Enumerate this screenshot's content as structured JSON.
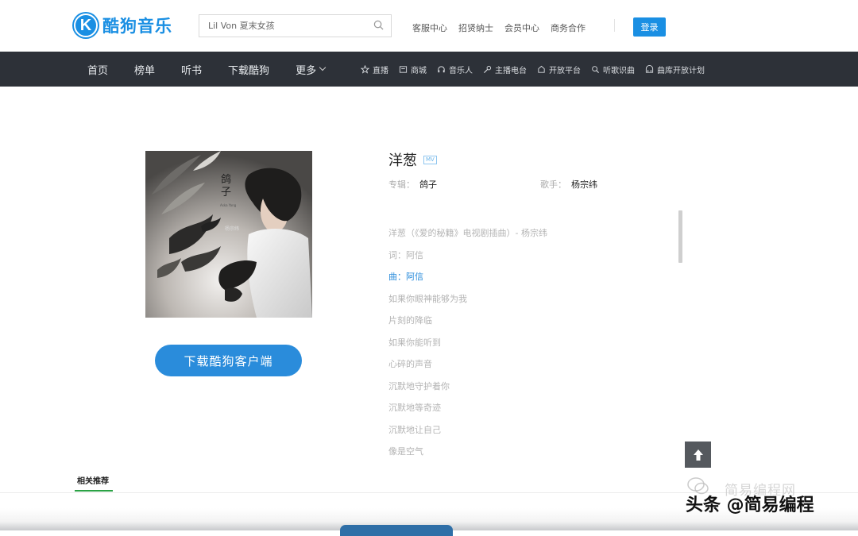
{
  "header": {
    "logo_letter": "K",
    "logo_text": "酷狗音乐",
    "brand_color": "#1a8fe3",
    "search_placeholder": "Lil Von 夏末女孩",
    "search_icon": "search-icon",
    "links": [
      "客服中心",
      "招贤纳士",
      "会员中心",
      "商务合作"
    ],
    "login_label": "登录"
  },
  "nav": {
    "main": [
      "首页",
      "榜单",
      "听书",
      "下载酷狗"
    ],
    "more_label": "更多",
    "sub": [
      {
        "label": "直播",
        "icon": "star-icon"
      },
      {
        "label": "商城",
        "icon": "shop-icon"
      },
      {
        "label": "音乐人",
        "icon": "headphone-icon"
      },
      {
        "label": "主播电台",
        "icon": "mic-icon"
      },
      {
        "label": "开放平台",
        "icon": "platform-icon"
      },
      {
        "label": "听歌识曲",
        "icon": "recognize-icon"
      },
      {
        "label": "曲库开放计划",
        "icon": "library-icon"
      }
    ]
  },
  "song": {
    "title": "洋葱",
    "mv_label": "MV",
    "album_label": "专辑：",
    "album": "鸽子",
    "singer_label": "歌手：",
    "singer": "杨宗纬",
    "cover_title": "鸽子",
    "cover_subtitle": "Aska Yang\nAlbum",
    "cover_artist": "杨宗纬"
  },
  "download_button": "下载酷狗客户端",
  "lyrics": [
    "洋葱（《爱的秘籍》电视剧插曲）- 杨宗纬",
    "词：阿信",
    "曲：阿信",
    "如果你眼神能够为我",
    "片刻的降临",
    "如果你能听到",
    "心碎的声音",
    "沉默地守护着你",
    "沉默地等奇迹",
    "沉默地让自己",
    "像是空气"
  ],
  "lyrics_active_index": 2,
  "related_label": "相关推荐",
  "watermark": {
    "ghost": "简易编程网",
    "main": "头条 @简易编程"
  },
  "colors": {
    "nav_bg": "#2d3138",
    "accent_blue": "#2a8cdb",
    "related_green": "#2ba245"
  }
}
